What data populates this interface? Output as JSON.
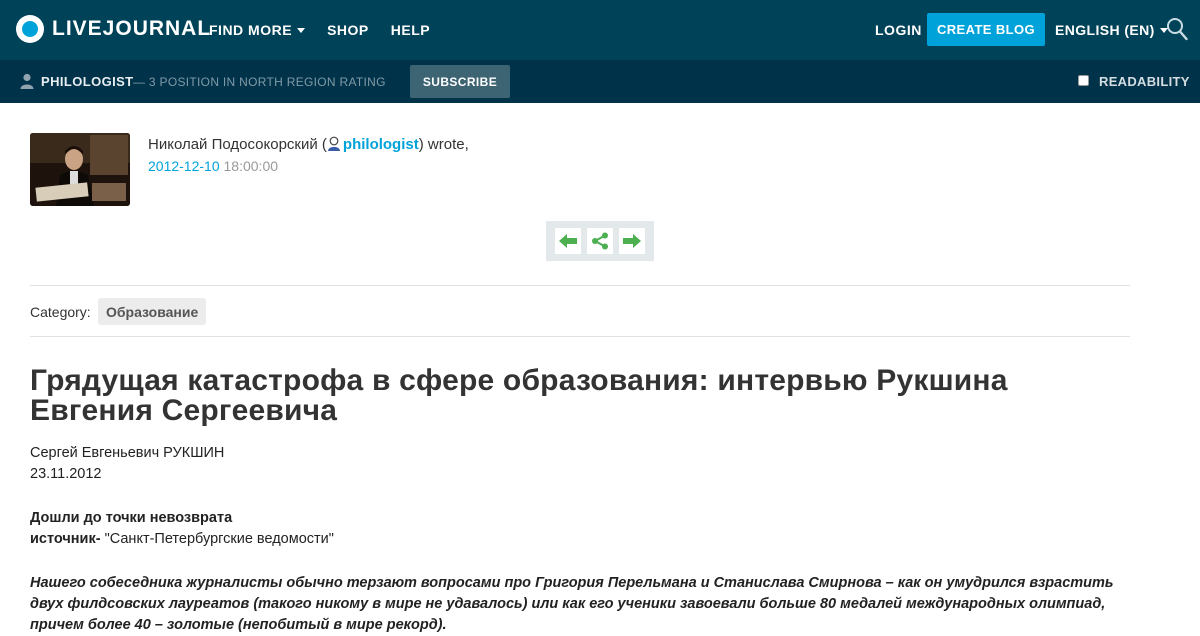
{
  "topbar": {
    "logo_text": "LIVEJOURNAL",
    "nav": [
      {
        "label": "FIND MORE",
        "has_dropdown": true
      },
      {
        "label": "SHOP",
        "has_dropdown": false
      },
      {
        "label": "HELP",
        "has_dropdown": false
      }
    ],
    "login_label": "LOGIN",
    "create_blog_label": "CREATE BLOG",
    "language_label": "ENGLISH (EN)",
    "search_icon": "search-icon"
  },
  "journal_bar": {
    "journal_name": "PHILOLOGIST",
    "rating_text": "— 3 POSITION IN NORTH REGION RATING",
    "subscribe_label": "SUBSCRIBE",
    "readability_label": "READABILITY",
    "readability_checked": false
  },
  "entry": {
    "author_name": "Николай Подосокорский (",
    "author_username": "philologist",
    "author_suffix": ") wrote,",
    "date": "2012-12-10",
    "time": "18:00:00",
    "category_label": "Category:",
    "category_tag": "Образование",
    "title": "Грядущая катастрофа в сфере образования: интервью Рукшина Евгения Сергеевича",
    "byline_name": "Сергей Евгеньевич РУКШИН",
    "byline_date": "23.11.2012",
    "heading": "Дошли до точки невозврата",
    "source_label": "источник-",
    "source_value": " \"Санкт-Петербургские ведомости\"",
    "lead": "Нашего собеседника журналисты обычно терзают вопросами про Григория Перельмана и Станислава Смирнова – как он умудрился взрастить двух филдсовских лауреатов (такого никому в мире не удавалось) или как его ученики завоевали больше 80 медалей международных олимпиад, причем более 40 – золотые (непобитый в мире рекорд)."
  },
  "colors": {
    "topbar_bg": "#004359",
    "subbar_bg": "#00334a",
    "accent": "#00a3d9",
    "nav_arrow_green": "#4caf50"
  }
}
